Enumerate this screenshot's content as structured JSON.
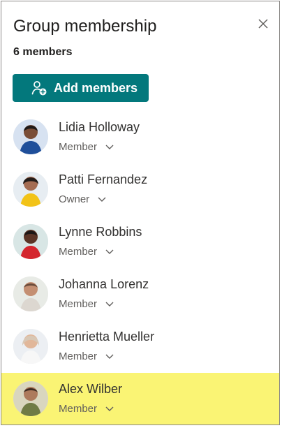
{
  "panel": {
    "title": "Group membership",
    "member_count": "6 members",
    "close_icon": "close-icon",
    "add_button": {
      "label": "Add members",
      "icon": "add-people-icon"
    }
  },
  "members": [
    {
      "name": "Lidia Holloway",
      "role": "Member",
      "selected": false
    },
    {
      "name": "Patti Fernandez",
      "role": "Owner",
      "selected": false
    },
    {
      "name": "Lynne Robbins",
      "role": "Member",
      "selected": false
    },
    {
      "name": "Johanna Lorenz",
      "role": "Member",
      "selected": false
    },
    {
      "name": "Henrietta Mueller",
      "role": "Member",
      "selected": false
    },
    {
      "name": "Alex Wilber",
      "role": "Member",
      "selected": true
    }
  ],
  "colors": {
    "accent": "#03787c",
    "highlight": "#faf474",
    "text": "#323130",
    "secondary_text": "#605e5c"
  }
}
